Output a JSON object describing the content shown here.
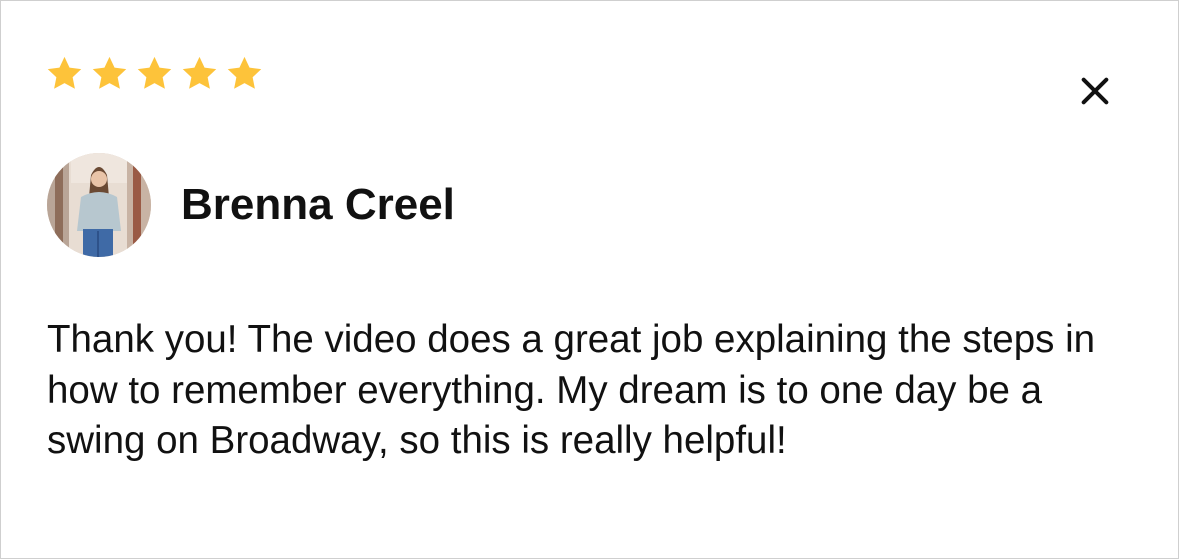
{
  "rating": {
    "stars": 5,
    "max_stars": 5,
    "star_color": "#FDC33A"
  },
  "close_button": {
    "icon": "close-icon"
  },
  "reviewer": {
    "name": "Brenna Creel",
    "avatar_icon": "avatar-photo"
  },
  "review": {
    "text": "Thank you! The video does a great job explaining the steps in how to remember everything. My dream is to one day be a swing on Broadway, so this is really helpful!"
  }
}
